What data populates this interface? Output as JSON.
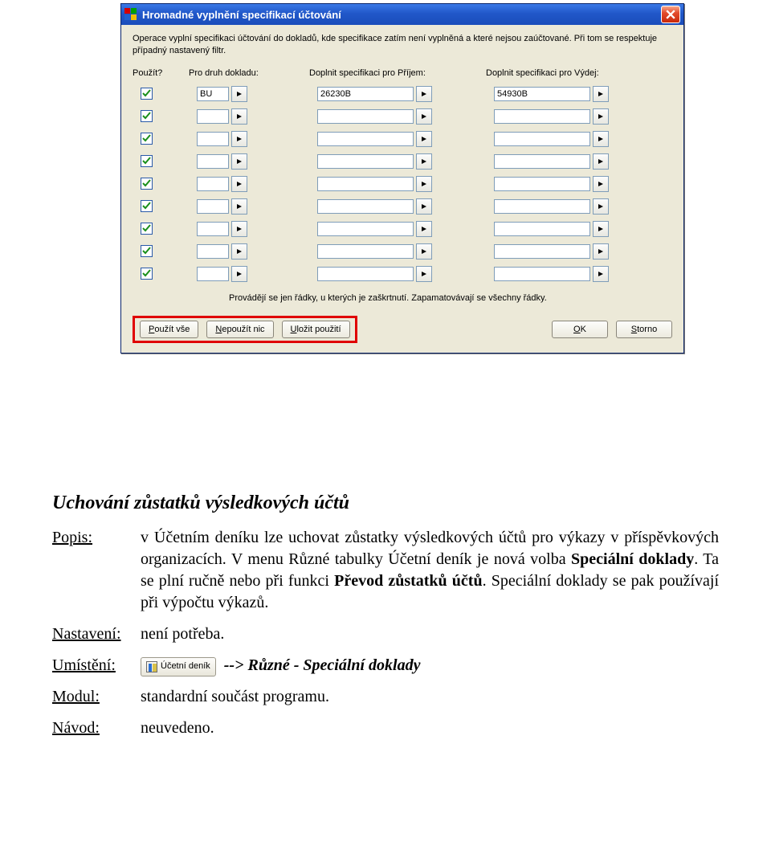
{
  "dialog": {
    "title": "Hromadné vyplnění specifikací účtování",
    "intro": "Operace vyplní specifikaci účtování do dokladů, kde specifikace zatím není vyplněná a které nejsou zaúčtované. Při tom se respektuje případný nastavený filtr.",
    "headers": {
      "use": "Použít?",
      "type": "Pro druh dokladu:",
      "in": "Doplnit specifikaci pro Příjem:",
      "out": "Doplnit specifikaci pro Výdej:"
    },
    "rows": [
      {
        "checked": true,
        "type": "BU",
        "in": "26230B",
        "out": "54930B"
      },
      {
        "checked": true,
        "type": "",
        "in": "",
        "out": ""
      },
      {
        "checked": true,
        "type": "",
        "in": "",
        "out": ""
      },
      {
        "checked": true,
        "type": "",
        "in": "",
        "out": ""
      },
      {
        "checked": true,
        "type": "",
        "in": "",
        "out": ""
      },
      {
        "checked": true,
        "type": "",
        "in": "",
        "out": ""
      },
      {
        "checked": true,
        "type": "",
        "in": "",
        "out": ""
      },
      {
        "checked": true,
        "type": "",
        "in": "",
        "out": ""
      },
      {
        "checked": true,
        "type": "",
        "in": "",
        "out": ""
      }
    ],
    "note": "Provádějí se jen řádky, u kterých je zaškrtnutí. Zapamatovávají se všechny řádky.",
    "buttons": {
      "use_all": "Použít vše",
      "use_none": "Nepoužít nic",
      "save_use": "Uložit použití",
      "ok": "OK",
      "cancel": "Storno"
    }
  },
  "doc": {
    "heading": "Uchování zůstatků výsledkových účtů",
    "labels": {
      "popis": "Popis:",
      "nastaveni": "Nastavení:",
      "umisteni": "Umístění:",
      "modul": "Modul:",
      "navod": "Návod:"
    },
    "popis_pre": "v Účetním deníku lze uchovat zůstatky výsledkových účtů pro výkazy v příspěvkových organizacích. V menu Různé tabulky Účetní deník je nová volba ",
    "popis_bold1": "Speciální doklady",
    "popis_mid": ". Ta se plní ručně nebo při funkci ",
    "popis_bold2": "Převod zůstatků účtů",
    "popis_post": ". Speciální doklady se pak používají při výpočtu výkazů.",
    "nastaveni": "není potřeba.",
    "umisteni_btn": "Účetní deník",
    "umisteni_path": "--> Různé - Speciální doklady",
    "modul": "standardní součást programu.",
    "navod": "neuvedeno."
  }
}
